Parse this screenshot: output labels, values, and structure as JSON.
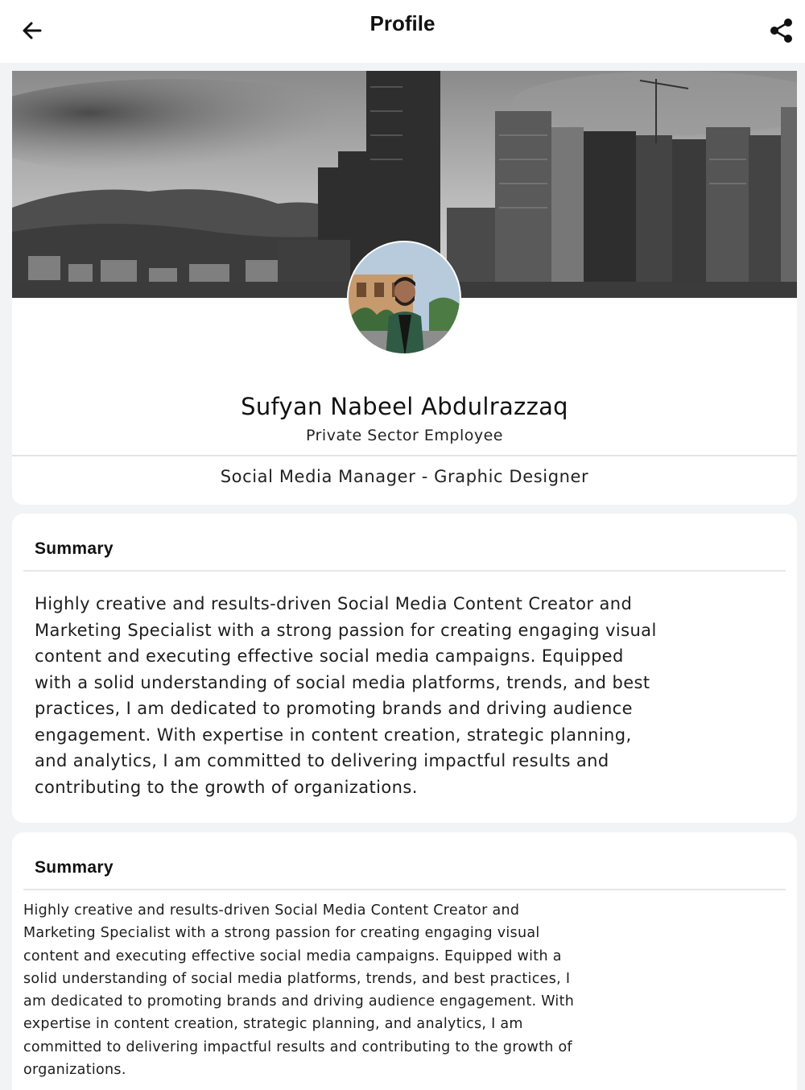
{
  "app_bar": {
    "title": "Profile",
    "back_icon": "arrow-left-icon",
    "share_icon": "share-icon"
  },
  "profile": {
    "name": "Sufyan Nabeel Abdulrazzaq",
    "occupation": "Private Sector Employee",
    "headline": "Social Media Manager - Graphic Designer",
    "cover_image": "city-skyline-cover",
    "avatar_image": "profile-photo"
  },
  "sections": [
    {
      "title": "Summary",
      "body": "Highly creative and results-driven Social Media Content Creator and Marketing Specialist with a strong passion for creating engaging visual content and executing effective social media campaigns. Equipped with a solid understanding of social media platforms, trends, and best practices, I am dedicated to promoting brands and driving audience engagement. With expertise in content creation, strategic planning, and analytics, I am committed to delivering impactful results and contributing to the growth of organizations."
    },
    {
      "title": "Summary",
      "body": "Highly creative and results-driven Social Media Content Creator and Marketing Specialist with a strong passion for creating engaging visual content and executing effective social media campaigns. Equipped with a solid understanding of social media platforms, trends, and best practices, I am dedicated to promoting brands and driving audience engagement. With expertise in content creation, strategic planning, and analytics, I am committed to delivering impactful results and contributing to the growth of organizations."
    }
  ],
  "colors": {
    "background": "#f2f3f5",
    "card": "#ffffff",
    "text": "#1a1a1a"
  }
}
